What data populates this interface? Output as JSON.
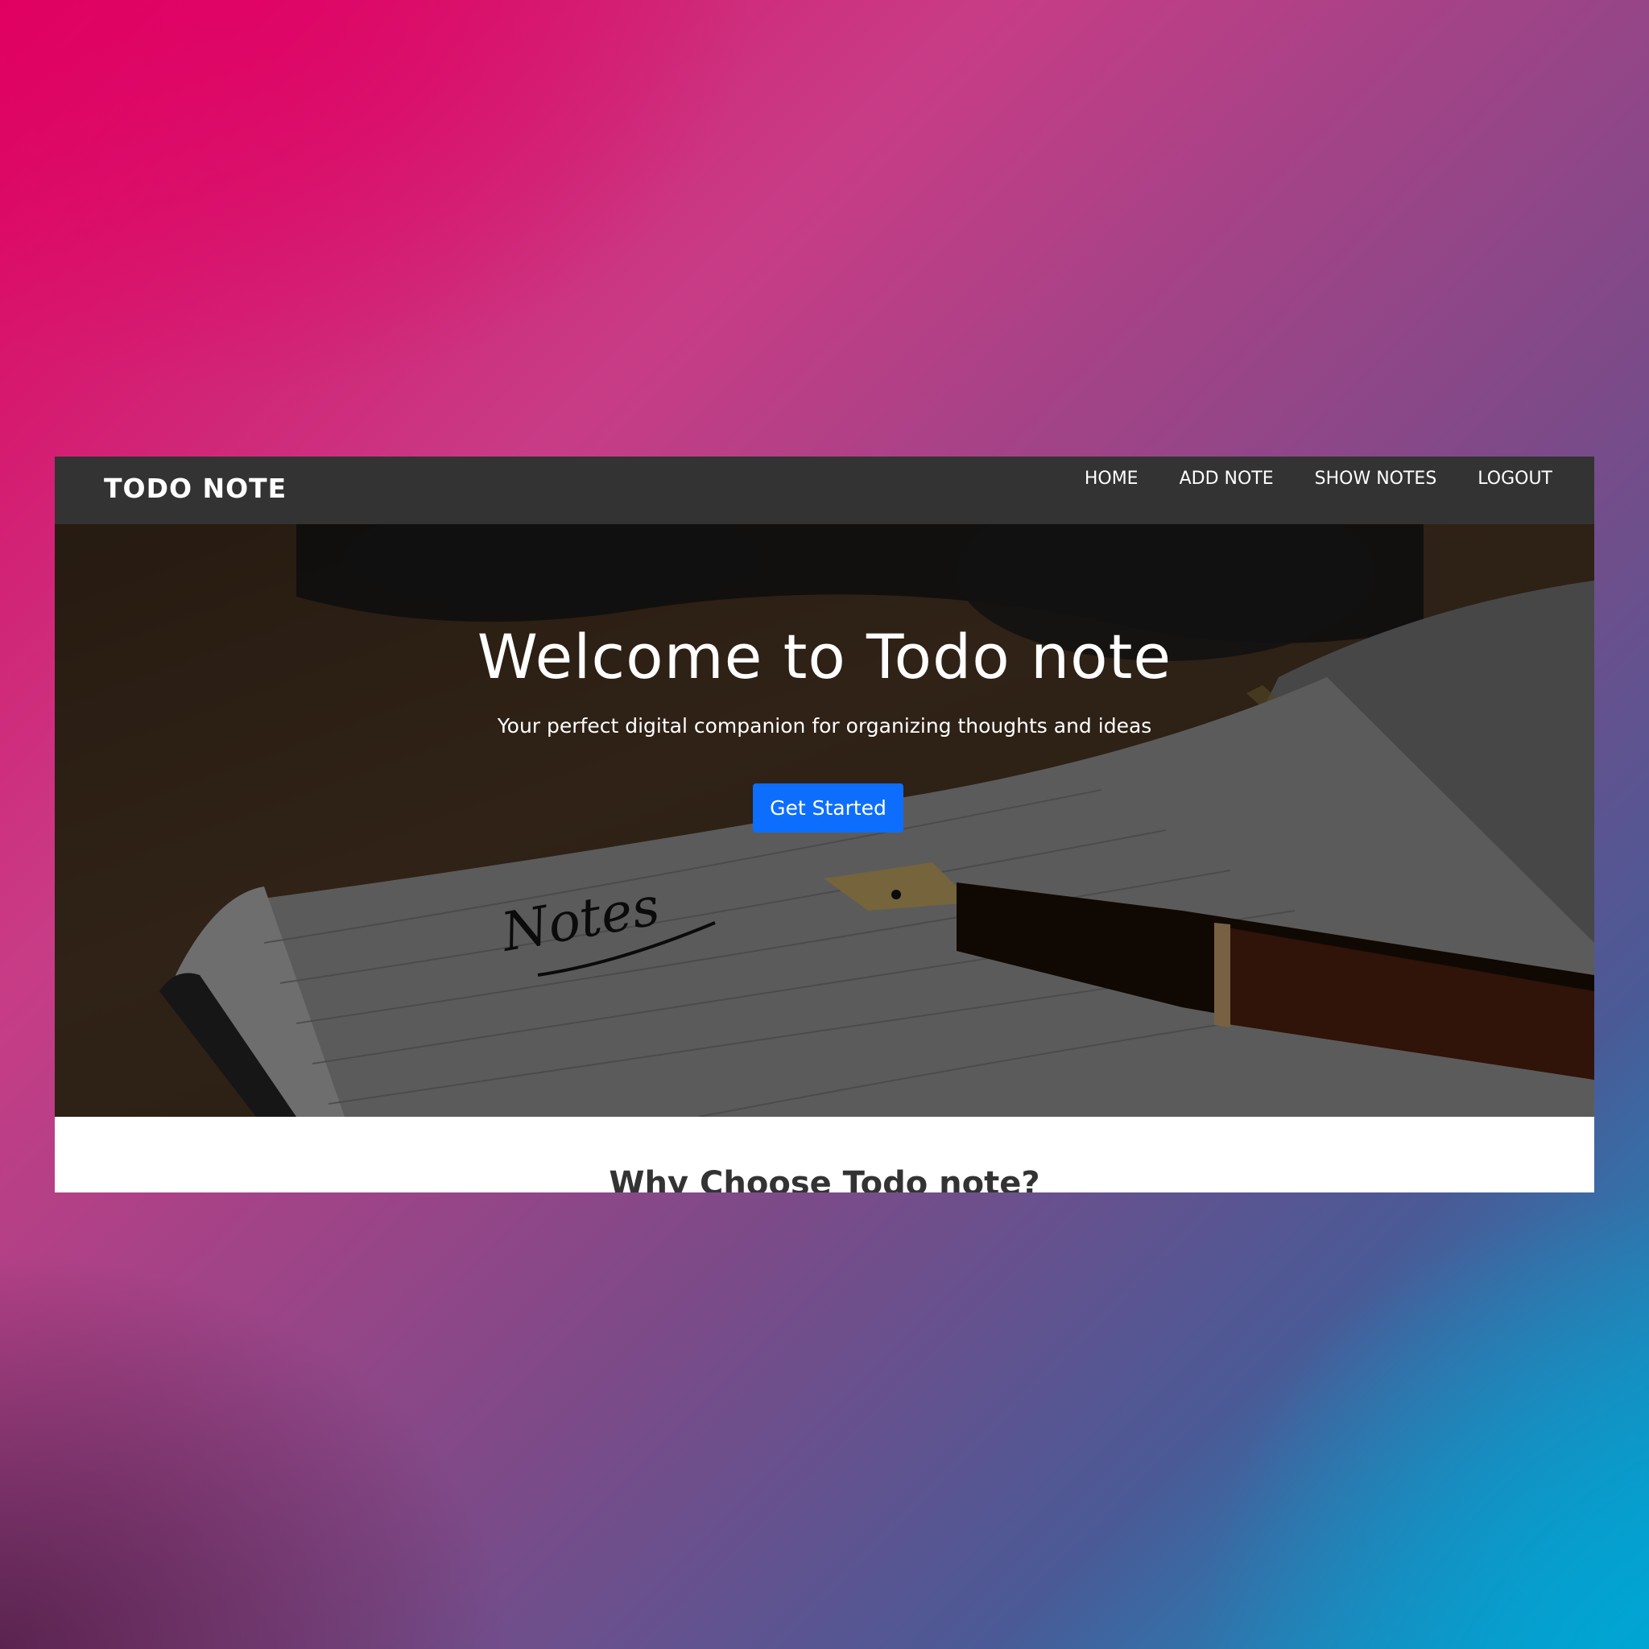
{
  "navbar": {
    "brand": "TODO NOTE",
    "links": [
      "HOME",
      "ADD NOTE",
      "SHOW NOTES",
      "LOGOUT"
    ]
  },
  "hero": {
    "title": "Welcome to Todo note",
    "subtitle": "Your perfect digital companion for organizing thoughts and ideas",
    "cta_label": "Get Started",
    "notebook_text": "Notes"
  },
  "why": {
    "title": "Why Choose Todo note?"
  },
  "colors": {
    "navbar": "#333333",
    "cta": "#0d6efd",
    "text_light": "#ffffff"
  }
}
